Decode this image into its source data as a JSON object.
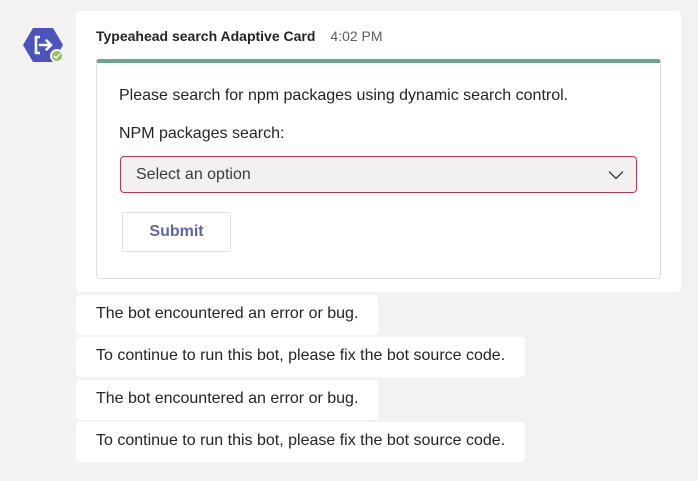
{
  "bot": {
    "avatar_icon": "exit-arrow-icon",
    "avatar_color": "#4b53bc",
    "presence_color": "#92c353",
    "presence_icon": "check-icon"
  },
  "message": {
    "sender": "Typeahead search Adaptive Card",
    "time": "4:02 PM"
  },
  "card": {
    "accent_color": "#6ba593",
    "text": "Please search for npm packages using dynamic search control.",
    "search_label": "NPM packages search:",
    "select_placeholder": "Select an option",
    "select_icon": "chevron-down-icon",
    "select_border_color": "#c4314b",
    "submit_label": "Submit",
    "submit_color": "#6264a7"
  },
  "replies": [
    {
      "text": "The bot encountered an error or bug."
    },
    {
      "text": "To continue to run this bot, please fix the bot source code."
    },
    {
      "text": "The bot encountered an error or bug."
    },
    {
      "text": "To continue to run this bot, please fix the bot source code."
    }
  ]
}
